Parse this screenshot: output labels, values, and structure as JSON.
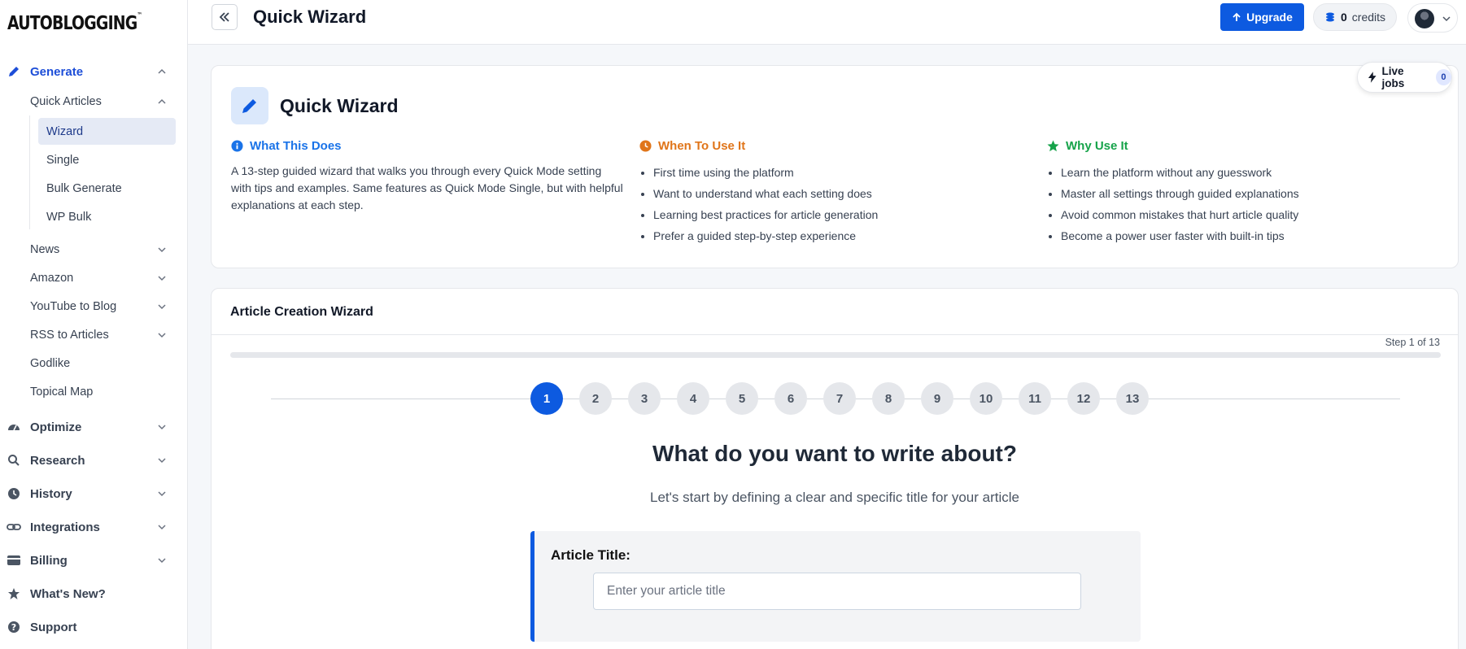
{
  "app": {
    "logo": "AUTOBLOGGING",
    "logo_tm": "™"
  },
  "sidebar": {
    "generate": {
      "label": "Generate",
      "icon": "pencil-icon"
    },
    "quick_articles": {
      "label": "Quick Articles"
    },
    "quick_items": [
      "Wizard",
      "Single",
      "Bulk Generate",
      "WP Bulk"
    ],
    "sub_items": [
      "News",
      "Amazon",
      "YouTube to Blog",
      "RSS to Articles",
      "Godlike",
      "Topical Map"
    ],
    "sections": [
      {
        "label": "Optimize",
        "icon": "gauge-icon"
      },
      {
        "label": "Research",
        "icon": "search-icon"
      },
      {
        "label": "History",
        "icon": "clock-icon"
      },
      {
        "label": "Integrations",
        "icon": "link-icon"
      },
      {
        "label": "Billing",
        "icon": "card-icon"
      },
      {
        "label": "What's New?",
        "icon": "star-icon"
      },
      {
        "label": "Support",
        "icon": "help-icon"
      }
    ]
  },
  "header": {
    "title": "Quick Wizard",
    "upgrade_label": "Upgrade",
    "credits_count": "0",
    "credits_label": "credits"
  },
  "info": {
    "title": "Quick Wizard",
    "what": {
      "heading": "What This Does",
      "text": "A 13-step guided wizard that walks you through every Quick Mode setting with tips and examples. Same features as Quick Mode Single, but with helpful explanations at each step."
    },
    "when": {
      "heading": "When To Use It",
      "items": [
        "First time using the platform",
        "Want to understand what each setting does",
        "Learning best practices for article generation",
        "Prefer a guided step-by-step experience"
      ]
    },
    "why": {
      "heading": "Why Use It",
      "items": [
        "Learn the platform without any guesswork",
        "Master all settings through guided explanations",
        "Avoid common mistakes that hurt article quality",
        "Become a power user faster with built-in tips"
      ]
    }
  },
  "live_jobs": {
    "label": "Live jobs",
    "count": "0"
  },
  "wizard": {
    "title": "Article Creation Wizard",
    "step_text": "Step 1 of 13",
    "progress": 0,
    "steps": [
      "1",
      "2",
      "3",
      "4",
      "5",
      "6",
      "7",
      "8",
      "9",
      "10",
      "11",
      "12",
      "13"
    ],
    "current_step": 1,
    "question": "What do you want to write about?",
    "subtitle": "Let's start by defining a clear and specific title for your article",
    "field_label": "Article Title:",
    "field_placeholder": "Enter your article title",
    "field_value": ""
  },
  "colors": {
    "primary": "#0d5ae0",
    "info_blue": "#1a73e8",
    "when_orange": "#e0751a",
    "why_green": "#16a34a"
  }
}
